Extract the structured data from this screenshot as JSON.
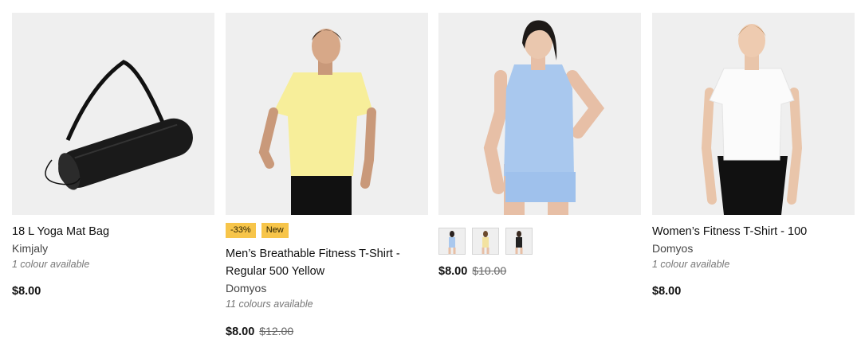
{
  "products": [
    {
      "title": "18 L Yoga Mat Bag",
      "brand": "Kimjaly",
      "colours": "1 colour available",
      "price": "$8.00"
    },
    {
      "badges": [
        "-33%",
        "New"
      ],
      "title": "Men’s Breathable Fitness T-Shirt - Regular 500 Yellow",
      "brand": "Domyos",
      "colours": "11 colours available",
      "price": "$8.00",
      "old_price": "$12.00"
    },
    {
      "swatch_colors": [
        "#a9c8ee",
        "#f3e2a0",
        "#222222"
      ],
      "price": "$8.00",
      "old_price": "$10.00"
    },
    {
      "title": "Women’s Fitness T-Shirt - 100",
      "brand": "Domyos",
      "colours": "1 colour available",
      "price": "$8.00"
    }
  ]
}
